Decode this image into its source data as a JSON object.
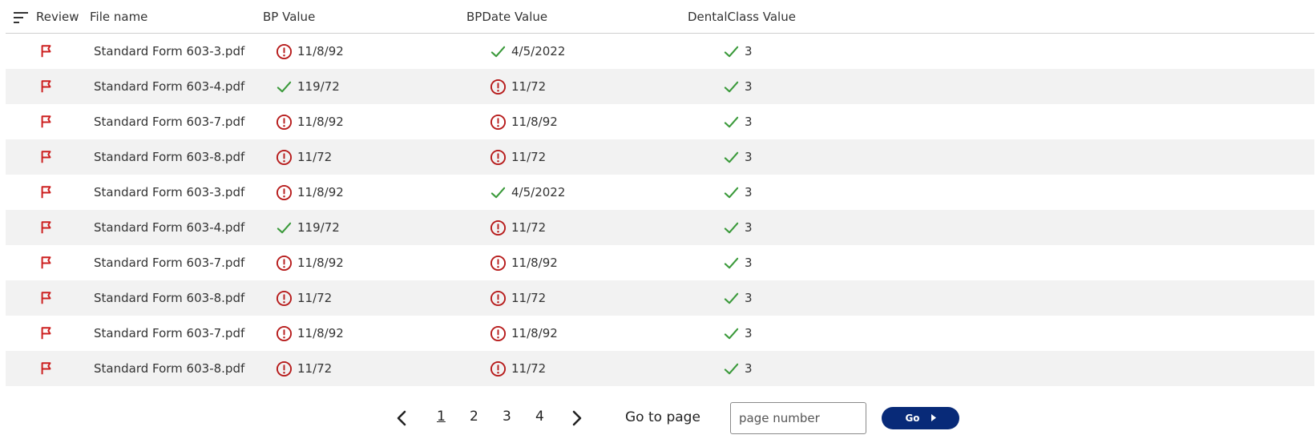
{
  "colors": {
    "accent": "#082a78",
    "flag": "#cc1f1f",
    "error": "#b71c1c",
    "ok": "#3b9a3b",
    "row_shade": "#f2f2f2"
  },
  "table": {
    "headers": {
      "review": "Review",
      "file_name": "File name",
      "bp_value": "BP Value",
      "bpdate_value": "BPDate Value",
      "dentalclass_value": "DentalClass Value"
    },
    "rows": [
      {
        "file": "Standard Form 603-3.pdf",
        "bp": "11/8/92",
        "bp_status": "error-icon",
        "bpdate": "4/5/2022",
        "bpdate_status": "check-icon",
        "dental": "3",
        "dental_status": "check-icon"
      },
      {
        "file": "Standard Form 603-4.pdf",
        "bp": "119/72",
        "bp_status": "check-icon",
        "bpdate": "11/72",
        "bpdate_status": "error-icon",
        "dental": "3",
        "dental_status": "check-icon"
      },
      {
        "file": "Standard Form 603-7.pdf",
        "bp": "11/8/92",
        "bp_status": "error-icon",
        "bpdate": "11/8/92",
        "bpdate_status": "error-icon",
        "dental": "3",
        "dental_status": "check-icon"
      },
      {
        "file": "Standard Form 603-8.pdf",
        "bp": "11/72",
        "bp_status": "error-icon",
        "bpdate": "11/72",
        "bpdate_status": "error-icon",
        "dental": "3",
        "dental_status": "check-icon"
      },
      {
        "file": "Standard Form 603-3.pdf",
        "bp": "11/8/92",
        "bp_status": "error-icon",
        "bpdate": "4/5/2022",
        "bpdate_status": "check-icon",
        "dental": "3",
        "dental_status": "check-icon"
      },
      {
        "file": "Standard Form 603-4.pdf",
        "bp": "119/72",
        "bp_status": "check-icon",
        "bpdate": "11/72",
        "bpdate_status": "error-icon",
        "dental": "3",
        "dental_status": "check-icon"
      },
      {
        "file": "Standard Form 603-7.pdf",
        "bp": "11/8/92",
        "bp_status": "error-icon",
        "bpdate": "11/8/92",
        "bpdate_status": "error-icon",
        "dental": "3",
        "dental_status": "check-icon"
      },
      {
        "file": "Standard Form 603-8.pdf",
        "bp": "11/72",
        "bp_status": "error-icon",
        "bpdate": "11/72",
        "bpdate_status": "error-icon",
        "dental": "3",
        "dental_status": "check-icon"
      },
      {
        "file": "Standard Form 603-7.pdf",
        "bp": "11/8/92",
        "bp_status": "error-icon",
        "bpdate": "11/8/92",
        "bpdate_status": "error-icon",
        "dental": "3",
        "dental_status": "check-icon"
      },
      {
        "file": "Standard Form 603-8.pdf",
        "bp": "11/72",
        "bp_status": "error-icon",
        "bpdate": "11/72",
        "bpdate_status": "error-icon",
        "dental": "3",
        "dental_status": "check-icon"
      }
    ]
  },
  "pagination": {
    "pages": [
      "1",
      "2",
      "3",
      "4"
    ],
    "current_page": "1",
    "goto_label": "Go to page",
    "input_placeholder": "page number",
    "go_label": "Go"
  }
}
